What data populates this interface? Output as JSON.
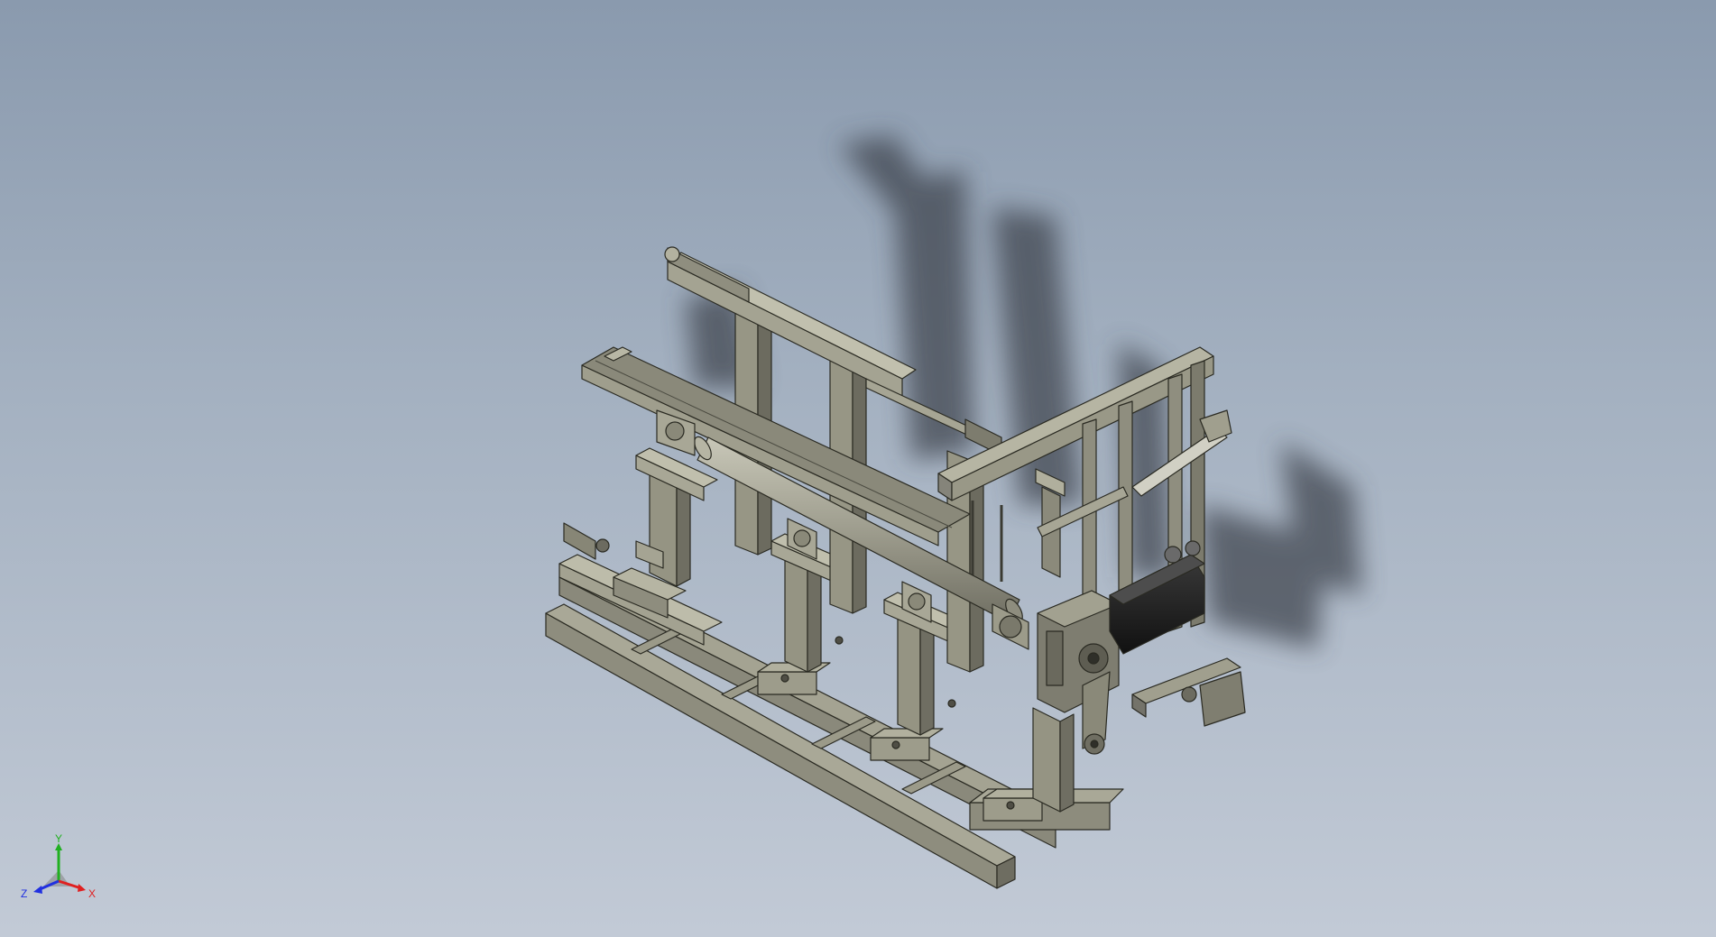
{
  "viewport": {
    "background_top": "#8a9aae",
    "background_bottom": "#c2cad6",
    "model_color": "#8a8a7a",
    "model_edge_color": "#2a2a22",
    "shadow_color": "#3a3f48"
  },
  "triad": {
    "x_label": "X",
    "y_label": "Y",
    "z_label": "Z",
    "x_color": "#e02020",
    "y_color": "#20b020",
    "z_color": "#2030e0"
  }
}
